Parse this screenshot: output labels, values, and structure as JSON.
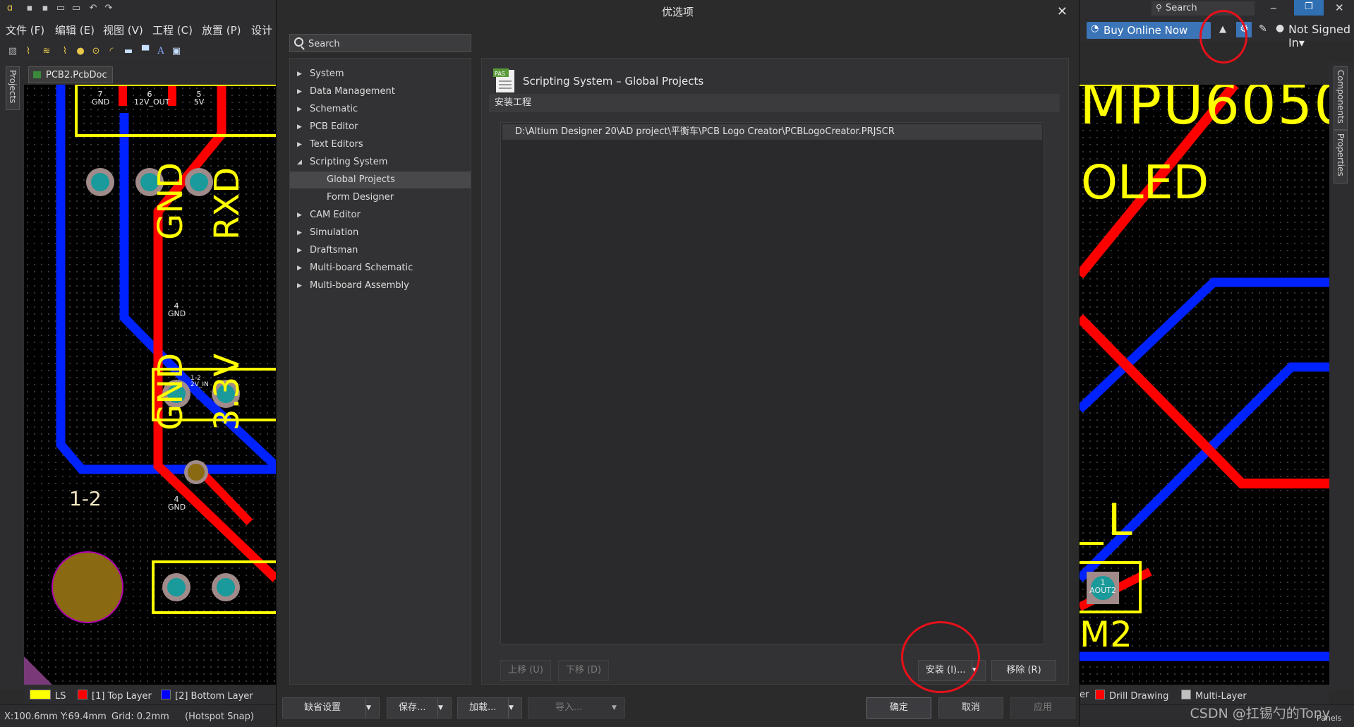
{
  "app": {
    "menu": [
      "文件 (F)",
      "编辑 (E)",
      "视图 (V)",
      "工程 (C)",
      "放置 (P)",
      "设计"
    ],
    "search_label": "Search",
    "buy_online": "Buy Online Now",
    "account": "Not Signed In",
    "side_tabs_left": [
      "Projects"
    ],
    "side_tabs_right": [
      "Components",
      "Properties"
    ],
    "doc_tab": "PCB2.PcbDoc *",
    "layers_left": [
      {
        "label": "LS",
        "color": "#ffff00"
      },
      {
        "label": "[1] Top Layer",
        "color": "#ff0000"
      },
      {
        "label": "[2] Bottom Layer",
        "color": "#0000ff"
      }
    ],
    "layers_right": [
      {
        "label": "er",
        "color": ""
      },
      {
        "label": "Drill Drawing",
        "color": "#ff0000"
      },
      {
        "label": "Multi-Layer",
        "color": "#c0c0c0"
      }
    ],
    "status": {
      "coords": "X:100.6mm Y:69.4mm",
      "grid": "Grid: 0.2mm",
      "snap": "(Hotspot Snap)"
    },
    "panels_label": "Panels",
    "watermark": "CSDN @扛锡勺的Tony"
  },
  "pcb_labels": {
    "left": [
      "GND",
      "RXD",
      "GND",
      "3.3V",
      "7",
      "GND",
      "6",
      "12V_OUT",
      "5",
      "5V",
      "4",
      "GND",
      "4",
      "GND",
      "1-2",
      "1-2",
      "2V_IN"
    ],
    "right": [
      "MPU6050",
      "OLED",
      "L",
      "M2",
      "1",
      "AOUT2"
    ]
  },
  "dialog": {
    "title": "优选项",
    "search_placeholder": "Search",
    "tree": [
      {
        "label": "System",
        "expanded": false,
        "child": false,
        "selected": false
      },
      {
        "label": "Data Management",
        "expanded": false,
        "child": false,
        "selected": false
      },
      {
        "label": "Schematic",
        "expanded": false,
        "child": false,
        "selected": false
      },
      {
        "label": "PCB Editor",
        "expanded": false,
        "child": false,
        "selected": false
      },
      {
        "label": "Text Editors",
        "expanded": false,
        "child": false,
        "selected": false
      },
      {
        "label": "Scripting System",
        "expanded": true,
        "child": false,
        "selected": false
      },
      {
        "label": "Global Projects",
        "expanded": false,
        "child": true,
        "selected": true
      },
      {
        "label": "Form Designer",
        "expanded": false,
        "child": true,
        "selected": false
      },
      {
        "label": "CAM Editor",
        "expanded": false,
        "child": false,
        "selected": false
      },
      {
        "label": "Simulation",
        "expanded": false,
        "child": false,
        "selected": false
      },
      {
        "label": "Draftsman",
        "expanded": false,
        "child": false,
        "selected": false
      },
      {
        "label": "Multi-board Schematic",
        "expanded": false,
        "child": false,
        "selected": false
      },
      {
        "label": "Multi-board Assembly",
        "expanded": false,
        "child": false,
        "selected": false
      }
    ],
    "page_icon_text": "PAS",
    "page_title": "Scripting System – Global Projects",
    "section_header": "安装工程",
    "projects": [
      "D:\\Altium Designer 20\\AD project\\平衡车\\PCB Logo Creator\\PCBLogoCreator.PRJSCR"
    ],
    "buttons": {
      "move_up": "上移 (U)",
      "move_down": "下移 (D)",
      "install": "安装 (I)...",
      "remove": "移除 (R)",
      "defaults": "缺省设置",
      "save": "保存...",
      "load": "加载...",
      "import": "导入...",
      "ok": "确定",
      "cancel": "取消",
      "apply": "应用"
    }
  },
  "colors": {
    "accent": "#3c74b8",
    "annotation": "#e8101a",
    "pcb_top": "#ff0000",
    "pcb_bottom": "#0022ff",
    "silkscreen": "#ffff00"
  }
}
